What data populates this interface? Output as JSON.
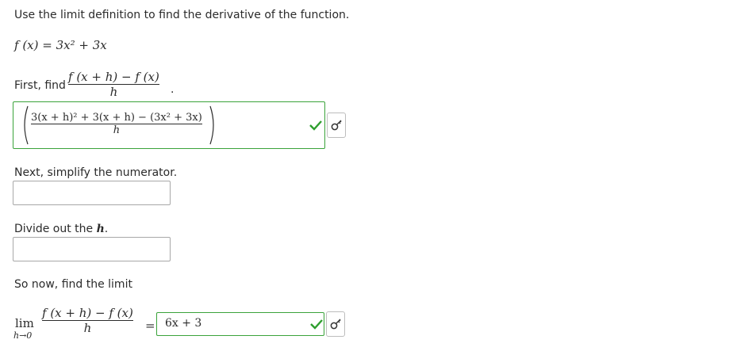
{
  "instruction": "Use the limit definition to find the derivative of the function.",
  "function_def": "f (x) = 3x² + 3x",
  "step1": {
    "label": "First, find",
    "frac_num": "f (x + h) − f (x)",
    "frac_den": "h",
    "period": ".",
    "answer_num": "3(x + h)² + 3(x + h) − (3x² + 3x)",
    "answer_den": "h"
  },
  "step2": {
    "label": "Next, simplify the numerator.",
    "value": ""
  },
  "step3": {
    "label": "Divide out the",
    "var": "h",
    "period": ".",
    "value": ""
  },
  "step4": {
    "label": "So now, find the limit",
    "lim": "lim",
    "lim_sub": "h→0",
    "frac_num": "f (x + h) − f (x)",
    "frac_den": "h",
    "equals": "=",
    "answer": "6x + 3"
  },
  "icons": {
    "check": "check-icon",
    "key": "answer-key-icon"
  },
  "colors": {
    "correct_border": "#3aa33a",
    "check": "#2e9e2e",
    "input_border": "#a8a8a8"
  }
}
